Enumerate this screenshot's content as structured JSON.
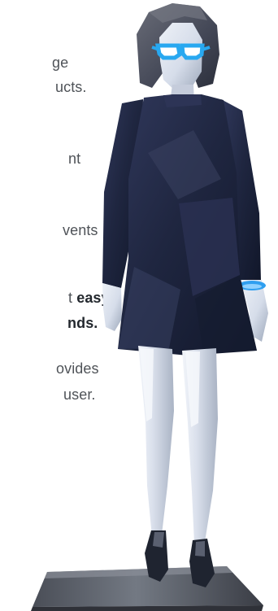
{
  "intro": {
    "lines": [
      "ge",
      "ucts.",
      "nt",
      "vents"
    ],
    "highlight_prefix": "t ",
    "highlight_word": "easy",
    "highlight_line2": "nds.",
    "tail_lines": [
      "ovides",
      "user."
    ]
  },
  "figure": {
    "icon": "mannequin-illustration",
    "colors": {
      "dress": "#1f2640",
      "dress_light": "#3a4160",
      "skin": "#d9dfeb",
      "skin_shadow": "#aeb8c9",
      "hair": "#424654",
      "base": "#5f646d",
      "glasses": "#28a8f0",
      "bracelet": "#2f9ff0"
    }
  }
}
